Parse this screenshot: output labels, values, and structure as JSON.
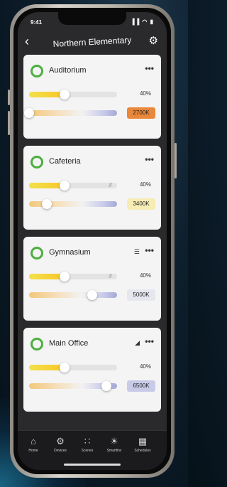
{
  "status": {
    "time": "9:41",
    "icons": "▐▐ ◠ ▮"
  },
  "header": {
    "title": "Northern Elementary",
    "back_icon": "‹",
    "settings_icon": "⚙"
  },
  "rooms": [
    {
      "name": "Auditorium",
      "level_label": "40%",
      "level": 0.4,
      "cct_label": "2700K",
      "cct": 0.0,
      "badge_color": "#e9873a",
      "control_icon": "",
      "hatched": false
    },
    {
      "name": "Cafeteria",
      "level_label": "40%",
      "level": 0.4,
      "cct_label": "3400K",
      "cct": 0.2,
      "badge_color": "#f6ecb4",
      "control_icon": "",
      "hatched": true
    },
    {
      "name": "Gymnasium",
      "level_label": "40%",
      "level": 0.4,
      "cct_label": "5000K",
      "cct": 0.72,
      "badge_color": "#e6e6ef",
      "control_icon": "☰",
      "hatched": true
    },
    {
      "name": "Main Office",
      "level_label": "40%",
      "level": 0.4,
      "cct_label": "6500K",
      "cct": 0.88,
      "badge_color": "#c8cbe8",
      "control_icon": "◢",
      "hatched": false
    }
  ],
  "more_icon": "•••",
  "hatch_text": "///",
  "accent": "#4caf3e",
  "tabs": [
    {
      "label": "Home",
      "icon": "⌂"
    },
    {
      "label": "Devices",
      "icon": "⚙"
    },
    {
      "label": "Scenes",
      "icon": "∷"
    },
    {
      "label": "Smartlinx",
      "icon": "☀"
    },
    {
      "label": "Schedules",
      "icon": "▦"
    }
  ]
}
